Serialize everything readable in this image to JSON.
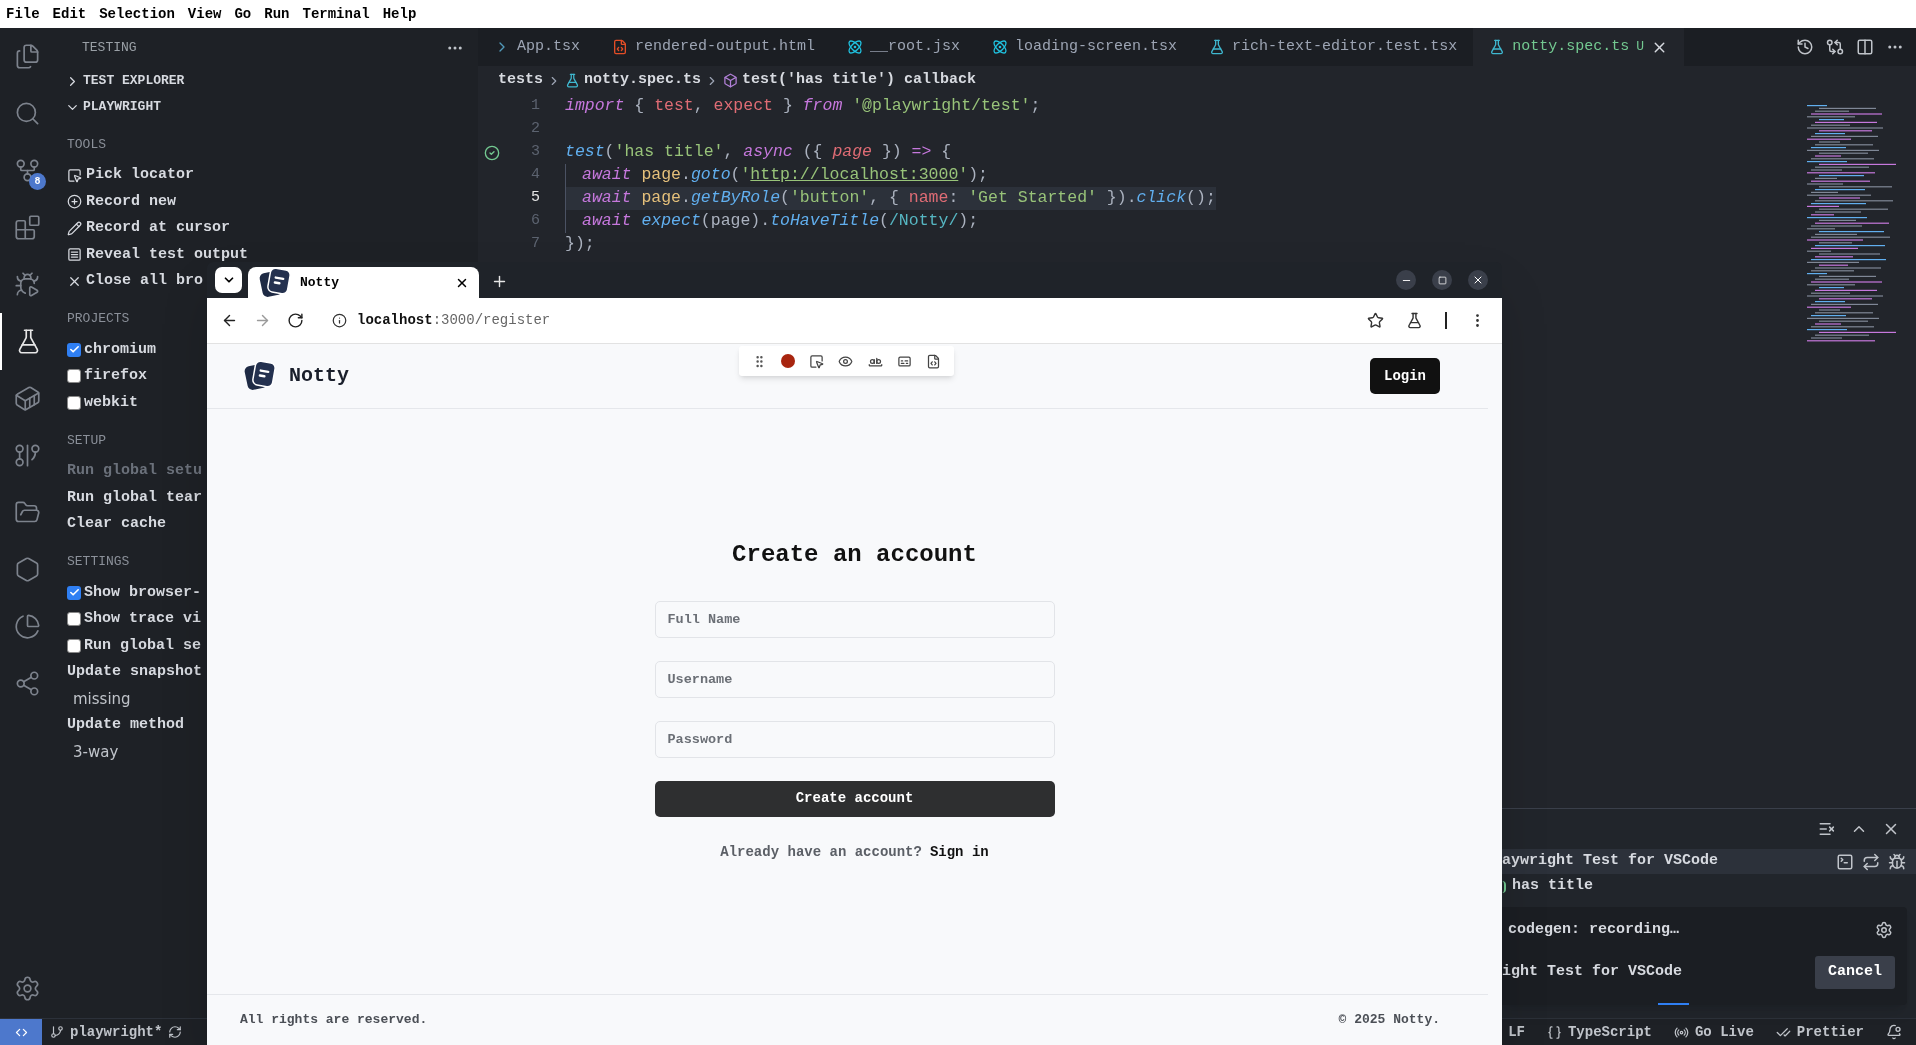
{
  "menu_bar": [
    "File",
    "Edit",
    "Selection",
    "View",
    "Go",
    "Run",
    "Terminal",
    "Help"
  ],
  "activity_bar": [
    {
      "kind": "explorer",
      "selected": false
    },
    {
      "kind": "search",
      "selected": false
    },
    {
      "kind": "source-control",
      "selected": false,
      "badge": "8"
    },
    {
      "kind": "extensions",
      "selected": false
    },
    {
      "kind": "run-debug",
      "selected": false
    },
    {
      "kind": "testing",
      "selected": true
    },
    {
      "kind": "docker",
      "selected": false
    },
    {
      "kind": "git-graph",
      "selected": false
    },
    {
      "kind": "folder",
      "selected": false
    },
    {
      "kind": "hexagon",
      "selected": false
    },
    {
      "kind": "pie",
      "selected": false
    },
    {
      "kind": "share",
      "selected": false
    }
  ],
  "sidebar": {
    "title": "TESTING",
    "sections": [
      {
        "label": "TEST EXPLORER",
        "expanded": false
      },
      {
        "label": "PLAYWRIGHT",
        "expanded": true
      }
    ],
    "groups": [
      {
        "heading": "TOOLS",
        "items": [
          {
            "kind": "pick-locator",
            "label": "Pick locator"
          },
          {
            "kind": "record-new",
            "label": "Record new"
          },
          {
            "kind": "record-at-cursor",
            "label": "Record at cursor"
          },
          {
            "kind": "reveal-output",
            "label": "Reveal test output"
          },
          {
            "kind": "close-browsers",
            "label": "Close all bro"
          }
        ]
      },
      {
        "heading": "PROJECTS",
        "items": [
          {
            "kind": "checkbox",
            "label": "chromium",
            "checked": true
          },
          {
            "kind": "checkbox",
            "label": "firefox",
            "checked": false
          },
          {
            "kind": "checkbox",
            "label": "webkit",
            "checked": false
          }
        ]
      },
      {
        "heading": "SETUP",
        "items": [
          {
            "kind": "command",
            "label": "Run global setu",
            "disabled": true
          },
          {
            "kind": "command",
            "label": "Run global tear",
            "disabled": false
          },
          {
            "kind": "command",
            "label": "Clear cache",
            "disabled": false
          }
        ]
      },
      {
        "heading": "SETTINGS",
        "items": [
          {
            "kind": "checkbox",
            "label": "Show browser-",
            "checked": true
          },
          {
            "kind": "checkbox",
            "label": "Show trace vi",
            "checked": false
          },
          {
            "kind": "checkbox",
            "label": "Run global se",
            "checked": false
          },
          {
            "kind": "select",
            "label": "Update snapshot",
            "value": "missing"
          },
          {
            "kind": "select",
            "label": "Update method",
            "value": "3-way"
          }
        ]
      }
    ]
  },
  "editor": {
    "tabs": [
      {
        "label": "App.tsx",
        "kind": "tsx",
        "selected": false
      },
      {
        "label": "rendered-output.html",
        "kind": "html",
        "selected": false
      },
      {
        "label": "__root.jsx",
        "kind": "react",
        "selected": false
      },
      {
        "label": "loading-screen.tsx",
        "kind": "react",
        "selected": false
      },
      {
        "label": "rich-text-editor.test.tsx",
        "kind": "test",
        "selected": false
      },
      {
        "label": "notty.spec.ts",
        "kind": "test",
        "selected": true,
        "status": "U"
      }
    ],
    "breadcrumb": [
      {
        "label": "tests",
        "kind": "folder"
      },
      {
        "label": "notty.spec.ts",
        "kind": "test-file"
      },
      {
        "label": "test('has title') callback",
        "kind": "symbol"
      }
    ],
    "lines": [
      {
        "number": "1",
        "current": false,
        "tokens": [
          {
            "text": "import",
            "kind": "keyword"
          },
          {
            "text": " { ",
            "kind": "punct"
          },
          {
            "text": "test",
            "kind": "variable"
          },
          {
            "text": ", ",
            "kind": "punct"
          },
          {
            "text": "expect",
            "kind": "variable"
          },
          {
            "text": " } ",
            "kind": "punct"
          },
          {
            "text": "from",
            "kind": "keyword"
          },
          {
            "text": " '@playwright/test'",
            "kind": "string"
          },
          {
            "text": ";",
            "kind": "punct"
          }
        ]
      },
      {
        "number": "2",
        "current": false
      },
      {
        "number": "3",
        "current": false,
        "test_passed": true,
        "tokens": [
          {
            "text": "test",
            "kind": "function"
          },
          {
            "text": "(",
            "kind": "punct"
          },
          {
            "text": "'has title'",
            "kind": "string"
          },
          {
            "text": ", ",
            "kind": "punct"
          },
          {
            "text": "async",
            "kind": "keyword"
          },
          {
            "text": " ({ ",
            "kind": "punct"
          },
          {
            "text": "page",
            "kind": "parameter"
          },
          {
            "text": " }) ",
            "kind": "punct"
          },
          {
            "text": "=>",
            "kind": "keyword"
          },
          {
            "text": " {",
            "kind": "punct"
          }
        ]
      },
      {
        "number": "4",
        "current": false,
        "indent_guide": true,
        "tokens": [
          {
            "text": "await",
            "kind": "keyword"
          },
          {
            "text": " page",
            "kind": "object"
          },
          {
            "text": ".",
            "kind": "punct"
          },
          {
            "text": "goto",
            "kind": "function"
          },
          {
            "text": "(",
            "kind": "punct"
          },
          {
            "text": "'",
            "kind": "string"
          },
          {
            "text": "http://localhost:3000",
            "kind": "link"
          },
          {
            "text": "'",
            "kind": "string"
          },
          {
            "text": ");",
            "kind": "punct"
          }
        ]
      },
      {
        "number": "5",
        "current": true,
        "indent_guide": true,
        "tokens": [
          {
            "text": "await",
            "kind": "keyword"
          },
          {
            "text": " page",
            "kind": "object"
          },
          {
            "text": ".",
            "kind": "punct"
          },
          {
            "text": "getByRole",
            "kind": "function"
          },
          {
            "text": "(",
            "kind": "punct"
          },
          {
            "text": "'button'",
            "kind": "string"
          },
          {
            "text": ", { ",
            "kind": "punct"
          },
          {
            "text": "name",
            "kind": "property"
          },
          {
            "text": ": ",
            "kind": "punct"
          },
          {
            "text": "'Get Started'",
            "kind": "string"
          },
          {
            "text": " }).",
            "kind": "punct"
          },
          {
            "text": "click",
            "kind": "function"
          },
          {
            "text": "();",
            "kind": "punct"
          }
        ]
      },
      {
        "number": "6",
        "current": false,
        "indent_guide": true,
        "tokens": [
          {
            "text": "await",
            "kind": "keyword"
          },
          {
            "text": " expect",
            "kind": "function"
          },
          {
            "text": "(page).",
            "kind": "punct"
          },
          {
            "text": "toHaveTitle",
            "kind": "function"
          },
          {
            "text": "(",
            "kind": "punct"
          },
          {
            "text": "/Notty/",
            "kind": "regex"
          },
          {
            "text": ");",
            "kind": "punct"
          }
        ]
      },
      {
        "number": "7",
        "current": false,
        "tokens": [
          {
            "text": "});",
            "kind": "punct"
          }
        ]
      }
    ]
  },
  "panel": {
    "rows": [
      {
        "label": "aywright Test for VSCode",
        "selected": true
      },
      {
        "label": "has title",
        "selected": false,
        "test_passed": true
      }
    ],
    "notification": {
      "title": "codegen: recording…",
      "source": "ight Test for VSCode",
      "button": "Cancel",
      "in_progress": true
    }
  },
  "status_bar": {
    "branch": "playwright*",
    "items": [
      {
        "kind": "eol",
        "label": "LF"
      },
      {
        "kind": "language",
        "label": "TypeScript"
      },
      {
        "kind": "live",
        "label": "Go Live"
      },
      {
        "kind": "prettier",
        "label": "Prettier"
      }
    ]
  },
  "browser": {
    "tabs": [
      {
        "title": "Notty",
        "selected": true
      }
    ],
    "nav": [
      {
        "kind": "back",
        "disabled": false
      },
      {
        "kind": "forward",
        "disabled": true
      },
      {
        "kind": "reload",
        "disabled": false
      }
    ],
    "url": {
      "host": "localhost",
      "rest": ":3000/register"
    },
    "recorder": [
      {
        "kind": "drag"
      },
      {
        "kind": "record",
        "on": true
      },
      {
        "kind": "pick"
      },
      {
        "kind": "visibility"
      },
      {
        "kind": "text"
      },
      {
        "kind": "value"
      },
      {
        "kind": "snapshot"
      }
    ],
    "page": {
      "brand": "Notty",
      "login": "Login",
      "heading": "Create an account",
      "fields": [
        {
          "placeholder": "Full Name"
        },
        {
          "placeholder": "Username"
        },
        {
          "placeholder": "Password"
        }
      ],
      "submit": "Create account",
      "prompt": "Already have an account?",
      "link": "Sign in",
      "footer_left": "All rights are reserved.",
      "footer_right": "© 2025 Notty."
    }
  }
}
